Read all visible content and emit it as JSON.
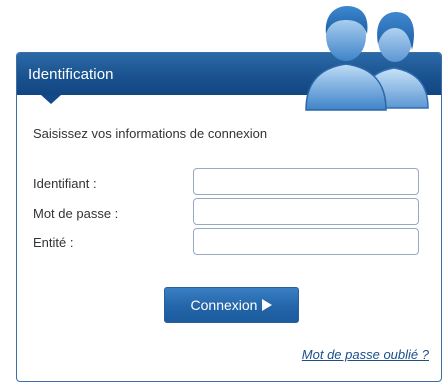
{
  "header": {
    "title": "Identification",
    "icon": "users-icon"
  },
  "form": {
    "intro": "Saisissez vos informations de connexion",
    "fields": [
      {
        "label": "Identifiant :",
        "value": "",
        "type": "text"
      },
      {
        "label": "Mot de passe :",
        "value": "",
        "type": "password"
      },
      {
        "label": "Entité :",
        "value": "",
        "type": "text"
      }
    ],
    "submit_label": "Connexion",
    "submit_icon": "play-icon",
    "forgot_label": "Mot de passe oublié ?"
  },
  "colors": {
    "header": "#1a5390",
    "button": "#2365a8",
    "link": "#1a4f8a",
    "border": "#3c6fa3"
  }
}
